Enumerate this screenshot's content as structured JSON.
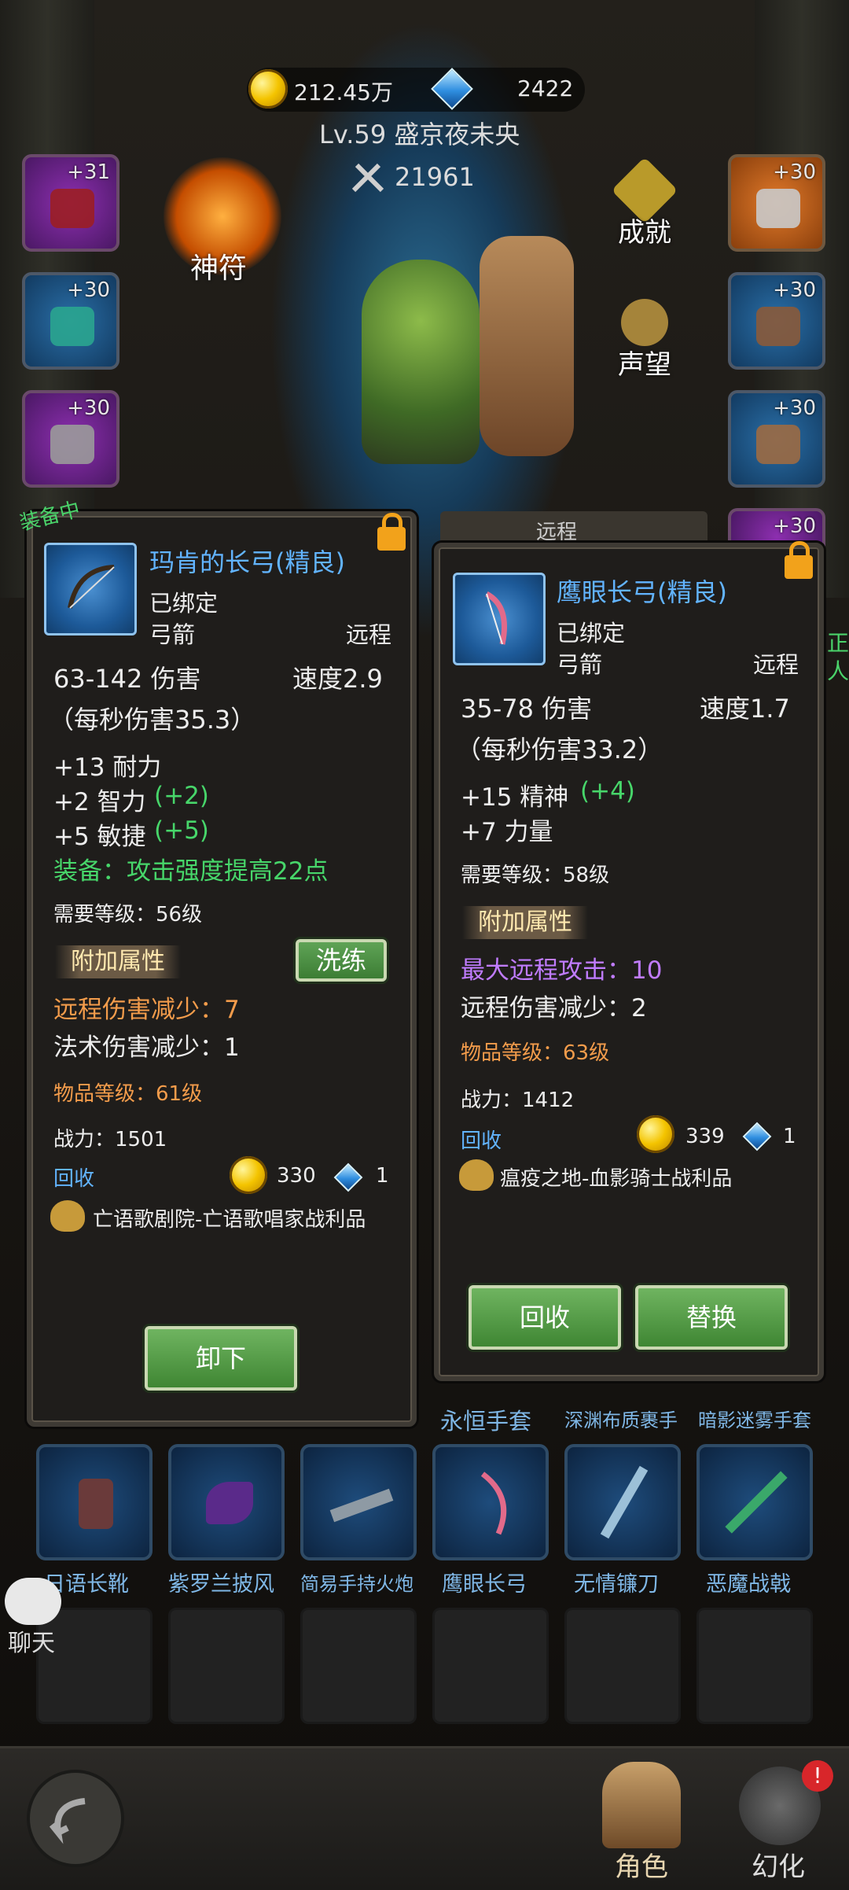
{
  "header": {
    "gold": "212.45万",
    "gems": "2422",
    "player": "Lv.59 盛京夜未央",
    "power": "21961"
  },
  "side_slots_left": [
    {
      "plus": "+31",
      "color": "purple",
      "icon": "helmet-icon"
    },
    {
      "plus": "+30",
      "color": "blue",
      "icon": "necklace-icon"
    },
    {
      "plus": "+30",
      "color": "purple",
      "icon": "shoulder-icon"
    }
  ],
  "side_slots_right": [
    {
      "plus": "+30",
      "color": "orange",
      "icon": "chest-armor-icon"
    },
    {
      "plus": "+30",
      "color": "blue",
      "icon": "legs-icon"
    },
    {
      "plus": "+30",
      "color": "blue",
      "icon": "boots-icon"
    },
    {
      "plus": "+30",
      "color": "purple",
      "icon": "ring-icon"
    }
  ],
  "center": {
    "rune_label": "神符",
    "achievement_label": "成就",
    "reputation_label": "声望"
  },
  "equipped_card": {
    "badge": "装备中",
    "name": "玛肯的长弓(精良)",
    "bound": "已绑定",
    "type": "弓箭",
    "slot": "远程",
    "damage": "63-142 伤害",
    "speed": "速度2.9",
    "dps": "（每秒伤害35.3）",
    "stats": [
      {
        "text": "+13 耐力",
        "bonus": ""
      },
      {
        "text": "+2 智力",
        "bonus": "(+2)"
      },
      {
        "text": "+5 敏捷",
        "bonus": "(+5)"
      }
    ],
    "equip_effect": "装备：攻击强度提高22点",
    "req_level": "需要等级：56级",
    "extra_title": "附加属性",
    "reforge_button": "洗练",
    "extra": [
      {
        "text": "远程伤害减少：7",
        "color": "orange"
      },
      {
        "text": "法术伤害减少：1",
        "color": "white"
      }
    ],
    "item_level": "物品等级：61级",
    "power": "战力：1501",
    "recycle_label": "回收",
    "recycle_gold": "330",
    "recycle_gem": "1",
    "source": "亡语歌剧院-亡语歌唱家战利品",
    "unequip_button": "卸下"
  },
  "compare_card": {
    "tab": "远程",
    "name": "鹰眼长弓(精良)",
    "bound": "已绑定",
    "type": "弓箭",
    "slot": "远程",
    "damage": "35-78 伤害",
    "speed": "速度1.7",
    "dps": "（每秒伤害33.2）",
    "stats": [
      {
        "text": "+15 精神",
        "bonus": "(+4)"
      },
      {
        "text": "+7 力量",
        "bonus": ""
      }
    ],
    "req_level": "需要等级：58级",
    "extra_title": "附加属性",
    "extra": [
      {
        "text": "最大远程攻击：10",
        "color": "purple"
      },
      {
        "text": "远程伤害减少：2",
        "color": "white"
      }
    ],
    "item_level": "物品等级：63级",
    "power": "战力：1412",
    "recycle_label": "回收",
    "recycle_gold": "339",
    "recycle_gem": "1",
    "source": "瘟疫之地-血影骑士战利品",
    "recycle_button": "回收",
    "replace_button": "替换"
  },
  "inventory_top_labels": [
    "永恒手套",
    "深渊布质裹手",
    "暗影迷雾手套"
  ],
  "inventory": [
    {
      "label": "日语长靴",
      "icon": "boots-icon"
    },
    {
      "label": "紫罗兰披风",
      "icon": "cloak-icon"
    },
    {
      "label": "简易手持火炮",
      "icon": "gun-icon"
    },
    {
      "label": "鹰眼长弓",
      "icon": "bow-icon"
    },
    {
      "label": "无情镰刀",
      "icon": "sword-icon"
    },
    {
      "label": "恶魔战戟",
      "icon": "halberd-icon"
    }
  ],
  "chat_label": "聊天",
  "side_peek": "正\n人",
  "nav": {
    "role_label": "角色",
    "transform_label": "幻化",
    "badge": "!"
  }
}
